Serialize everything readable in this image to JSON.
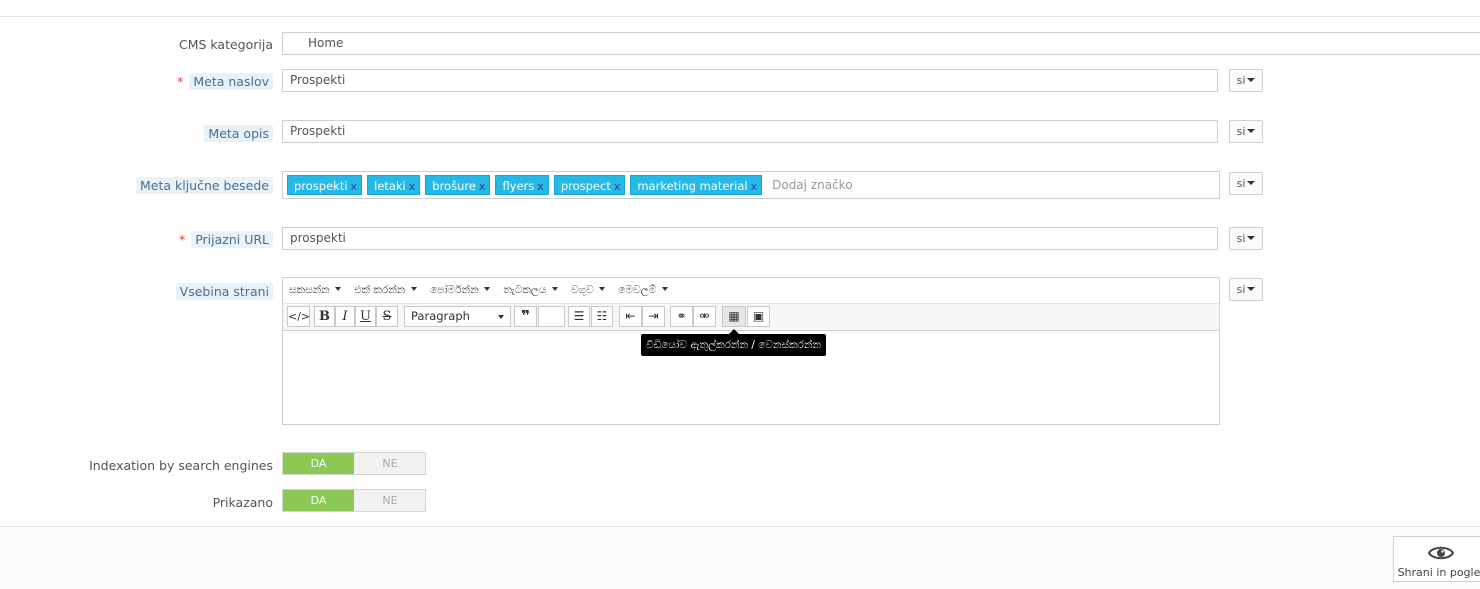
{
  "form": {
    "cms_category": {
      "label": "CMS kategorija",
      "value": "Home"
    },
    "meta_title": {
      "label": "Meta naslov",
      "value": "Prospekti",
      "lang": "si",
      "required_mark": "*"
    },
    "meta_description": {
      "label": "Meta opis",
      "value": "Prospekti",
      "lang": "si"
    },
    "meta_keywords": {
      "label": "Meta ključne besede",
      "tags": [
        "prospekti",
        "letaki",
        "brošure",
        "flyers",
        "prospect",
        "marketing material"
      ],
      "tag_remove": "x",
      "placeholder": "Dodaj značko",
      "lang": "si"
    },
    "friendly_url": {
      "label": "Prijazni URL",
      "value": "prospekti",
      "lang": "si",
      "required_mark": "*"
    },
    "page_content": {
      "label": "Vsebina strani",
      "lang": "si",
      "menus": [
        "සකසන්න",
        "එක් කරන්න",
        "පෝර්මන්න",
        "තැටකලය",
        "වගුව",
        "මෙවලම්"
      ],
      "format_select": "Paragraph",
      "tooltip": "වීඩියෝව ඇතුල්කරන්න / වෙනස්කරන්න"
    },
    "indexation": {
      "label": "Indexation by search engines",
      "yes": "DA",
      "no": "NE",
      "selected": "DA"
    },
    "displayed": {
      "label": "Prikazano",
      "yes": "DA",
      "no": "NE",
      "selected": "DA"
    }
  },
  "footer": {
    "save_preview_label": "Shrani in poglej",
    "icon": "eye-icon"
  }
}
